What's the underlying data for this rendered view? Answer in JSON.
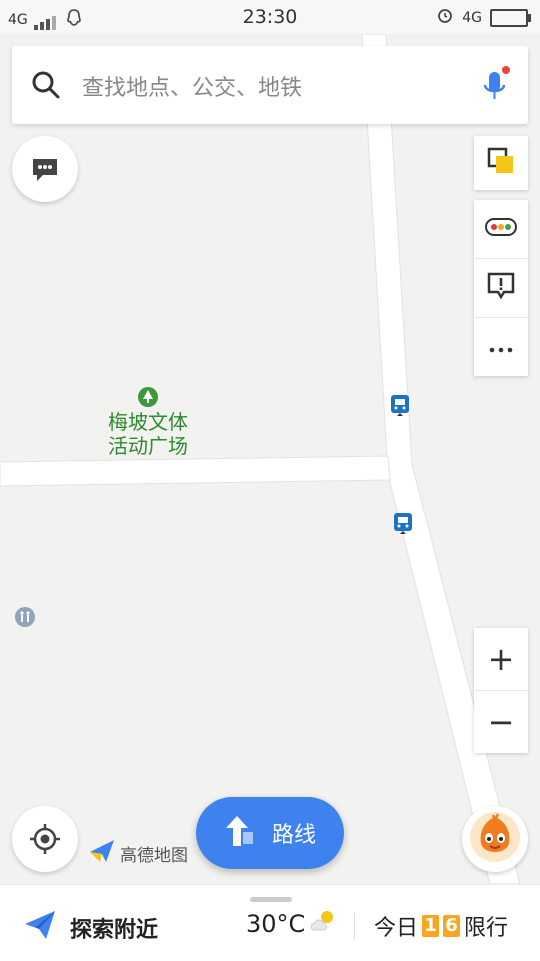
{
  "status_bar": {
    "network_left": "4G",
    "time": "23:30",
    "network_right": "4G"
  },
  "search": {
    "placeholder": "查找地点、公交、地铁"
  },
  "map": {
    "poi_line1": "梅坡文体",
    "poi_line2": "活动广场"
  },
  "controls": {
    "zoom_in": "+",
    "zoom_out": "−"
  },
  "logo": {
    "text": "高德地图"
  },
  "route_button": {
    "label": "路线"
  },
  "bottom_bar": {
    "explore_label": "探索附近",
    "temperature": "30°C",
    "restrict_prefix": "今日",
    "restrict_digit1": "1",
    "restrict_digit2": "6",
    "restrict_suffix": "限行"
  },
  "colors": {
    "accent": "#3d82ef",
    "poi_green": "#2f8a2f",
    "restrict_orange": "#f5a623",
    "bus_blue": "#1a73c7"
  }
}
